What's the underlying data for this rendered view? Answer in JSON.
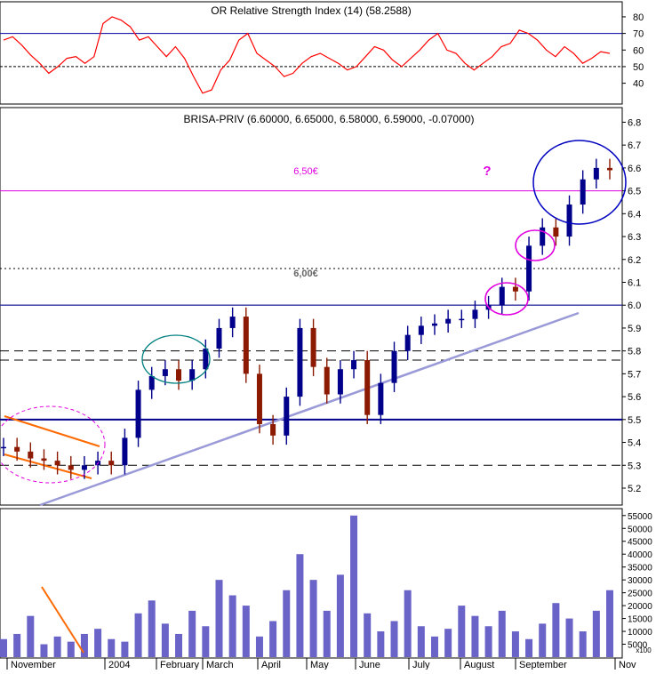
{
  "rsi_panel": {
    "title": "OR Relative Strength Index (14) (58.2588)",
    "ticks": [
      80,
      70,
      60,
      50,
      40
    ],
    "ylim": [
      28,
      88
    ]
  },
  "price_panel": {
    "title": "BRISA-PRIV (6.60000, 6.65000, 6.58000, 6.59000, -0.07000)",
    "ticks": [
      "6.8",
      "6.7",
      "6.6",
      "6.5",
      "6.4",
      "6.3",
      "6.2",
      "6.1",
      "6.0",
      "5.9",
      "5.8",
      "5.7",
      "5.6",
      "5.5",
      "5.4",
      "5.3",
      "5.2"
    ],
    "ylim": [
      5.13,
      6.86
    ],
    "annotations": {
      "level_650": "6,50€",
      "level_600": "6,00€",
      "question_mark": "?"
    }
  },
  "volume_panel": {
    "ticks": [
      "55000",
      "50000",
      "45000",
      "40000",
      "35000",
      "30000",
      "25000",
      "20000",
      "15000",
      "10000",
      "5000"
    ],
    "multiplier_label": "x100",
    "ylim": [
      0,
      57000
    ]
  },
  "x_axis": {
    "labels": [
      "November",
      "2004",
      "February",
      "March",
      "April",
      "May",
      "June",
      "July",
      "August",
      "September",
      "Nov"
    ]
  },
  "colors": {
    "up": "#00008b",
    "down": "#8b1a00",
    "rsi_line": "#ff0000",
    "volume": "#6a64c8",
    "support_line": "#9a9ad8",
    "magenta": "#e000e0",
    "orange": "#ff6a00",
    "blue_ellipse": "#0000c0",
    "green_ellipse": "#008080",
    "grid": "#000000"
  },
  "chart_data": [
    {
      "type": "line",
      "title": "OR Relative Strength Index (14) (58.2588)",
      "x_labels": [
        "November",
        "2004",
        "February",
        "March",
        "April",
        "May",
        "June",
        "July",
        "August",
        "September"
      ],
      "series": [
        {
          "name": "Relative Strength Index (14)",
          "values": [
            66,
            68,
            63,
            57,
            52,
            46,
            50,
            55,
            56,
            52,
            56,
            76,
            80,
            78,
            74,
            66,
            68,
            62,
            56,
            62,
            55,
            44,
            34,
            36,
            48,
            54,
            66,
            70,
            58,
            54,
            50,
            44,
            46,
            52,
            56,
            58,
            55,
            52,
            48,
            50,
            56,
            62,
            60,
            54,
            50,
            55,
            60,
            66,
            70,
            60,
            58,
            52,
            48,
            52,
            56,
            62,
            64,
            72,
            70,
            66,
            60,
            56,
            62,
            58,
            52,
            55,
            59,
            58
          ]
        }
      ],
      "ylim": [
        28,
        88
      ],
      "reference_lines": [
        70,
        50
      ]
    },
    {
      "type": "line",
      "title": "BRISA-PRIV (6.60000, 6.65000, 6.58000, 6.59000, -0.07000)",
      "x_labels": [
        "November",
        "2004",
        "February",
        "March",
        "April",
        "May",
        "June",
        "July",
        "August",
        "September"
      ],
      "series": [
        {
          "name": "BRISA-PRIV",
          "values": [
            5.38,
            5.36,
            5.33,
            5.32,
            5.3,
            5.28,
            5.3,
            5.32,
            5.3,
            5.42,
            5.63,
            5.69,
            5.72,
            5.67,
            5.72,
            5.81,
            5.9,
            5.95,
            5.7,
            5.48,
            5.43,
            5.6,
            5.9,
            5.73,
            5.61,
            5.72,
            5.76,
            5.52,
            5.66,
            5.8,
            5.87,
            5.91,
            5.92,
            5.94,
            5.94,
            5.98,
            6.0,
            6.08,
            6.06,
            6.26,
            6.34,
            6.3,
            6.44,
            6.55,
            6.6,
            6.59
          ]
        }
      ],
      "ylim": [
        5.13,
        6.86
      ],
      "horizontal_levels": [
        {
          "value": 6.5,
          "label": "6,50€"
        },
        {
          "value": 6.0,
          "label": "6,00€"
        },
        {
          "value": 5.5,
          "label": ""
        },
        {
          "value": 6.16,
          "label": ""
        },
        {
          "value": 5.8,
          "label": ""
        },
        {
          "value": 5.76,
          "label": ""
        },
        {
          "value": 5.3,
          "label": ""
        }
      ],
      "annotations": [
        "6,50€",
        "6,00€",
        "?"
      ]
    },
    {
      "type": "bar",
      "x_labels": [
        "November",
        "2004",
        "February",
        "March",
        "April",
        "May",
        "June",
        "July",
        "August",
        "September"
      ],
      "series": [
        {
          "name": "Volume",
          "values": [
            7000,
            9000,
            16000,
            5000,
            8000,
            6000,
            9000,
            11000,
            7000,
            6000,
            17000,
            22000,
            13000,
            9000,
            18000,
            12000,
            30000,
            24000,
            20000,
            8000,
            14000,
            26000,
            40000,
            30000,
            18000,
            32000,
            55000,
            17000,
            10000,
            14000,
            26000,
            12000,
            8000,
            11000,
            20000,
            16000,
            12000,
            18000,
            10000,
            7000,
            13000,
            21000,
            15000,
            10000,
            18000,
            26000
          ]
        }
      ],
      "ylim": [
        0,
        57000
      ],
      "units": "x100"
    }
  ]
}
